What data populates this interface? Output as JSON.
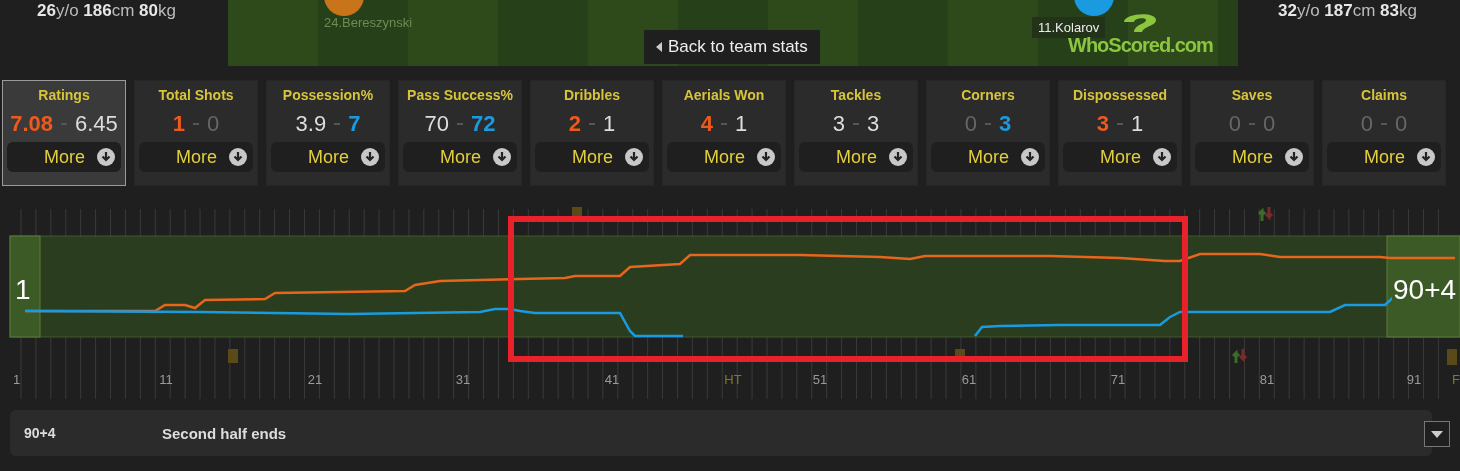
{
  "home_player": {
    "stats": "**26**y/o **186**cm **80**kg",
    "pitch_name_number": "24.",
    "pitch_name": "Bereszynski",
    "color": "#c8741a"
  },
  "away_player": {
    "stats": "**32**y/o **187**cm **83**kg",
    "pitch_name_number": "11.",
    "pitch_name": "Kolarov",
    "color": "#1a9be0"
  },
  "back_button": "Back to team stats",
  "logo": "WhoScored.com",
  "stat_cards": [
    {
      "title": "Ratings",
      "home": {
        "value": "7.08",
        "color": "#ee5a1c"
      },
      "away": {
        "value": "6.45",
        "color": "#dddddd"
      },
      "more": "More",
      "selected": true
    },
    {
      "title": "Total Shots",
      "home": {
        "value": "1",
        "color": "#ee5a1c"
      },
      "away": {
        "value": "0",
        "color": "#666666"
      },
      "more": "More",
      "selected": false
    },
    {
      "title": "Possession%",
      "home": {
        "value": "3.9",
        "color": "#dddddd"
      },
      "away": {
        "value": "7",
        "color": "#1a9be0"
      },
      "more": "More",
      "selected": false
    },
    {
      "title": "Pass Success%",
      "home": {
        "value": "70",
        "color": "#dddddd"
      },
      "away": {
        "value": "72",
        "color": "#1a9be0"
      },
      "more": "More",
      "selected": false
    },
    {
      "title": "Dribbles",
      "home": {
        "value": "2",
        "color": "#ee5a1c"
      },
      "away": {
        "value": "1",
        "color": "#dddddd"
      },
      "more": "More",
      "selected": false
    },
    {
      "title": "Aerials Won",
      "home": {
        "value": "4",
        "color": "#ee5a1c"
      },
      "away": {
        "value": "1",
        "color": "#dddddd"
      },
      "more": "More",
      "selected": false
    },
    {
      "title": "Tackles",
      "home": {
        "value": "3",
        "color": "#dddddd"
      },
      "away": {
        "value": "3",
        "color": "#dddddd"
      },
      "more": "More",
      "selected": false
    },
    {
      "title": "Corners",
      "home": {
        "value": "0",
        "color": "#666666"
      },
      "away": {
        "value": "3",
        "color": "#1a9be0"
      },
      "more": "More",
      "selected": false
    },
    {
      "title": "Dispossessed",
      "home": {
        "value": "3",
        "color": "#ee5a1c"
      },
      "away": {
        "value": "1",
        "color": "#dddddd"
      },
      "more": "More",
      "selected": false
    },
    {
      "title": "Saves",
      "home": {
        "value": "0",
        "color": "#666666"
      },
      "away": {
        "value": "0",
        "color": "#666666"
      },
      "more": "More",
      "selected": false
    },
    {
      "title": "Claims",
      "home": {
        "value": "0",
        "color": "#666666"
      },
      "away": {
        "value": "0",
        "color": "#666666"
      },
      "more": "More",
      "selected": false
    }
  ],
  "timeline": {
    "start_label": "1",
    "end_label": "90+4",
    "ticks": [
      {
        "label": "1",
        "kind": "minute"
      },
      {
        "label": "11",
        "kind": "minute"
      },
      {
        "label": "21",
        "kind": "minute"
      },
      {
        "label": "31",
        "kind": "minute"
      },
      {
        "label": "41",
        "kind": "minute"
      },
      {
        "label": "HT",
        "kind": "period"
      },
      {
        "label": "51",
        "kind": "minute"
      },
      {
        "label": "61",
        "kind": "minute"
      },
      {
        "label": "71",
        "kind": "minute"
      },
      {
        "label": "81",
        "kind": "minute"
      },
      {
        "label": "91",
        "kind": "minute"
      },
      {
        "label": "F",
        "kind": "period"
      }
    ]
  },
  "event": {
    "minute": "90+4",
    "text": "Second half ends"
  }
}
